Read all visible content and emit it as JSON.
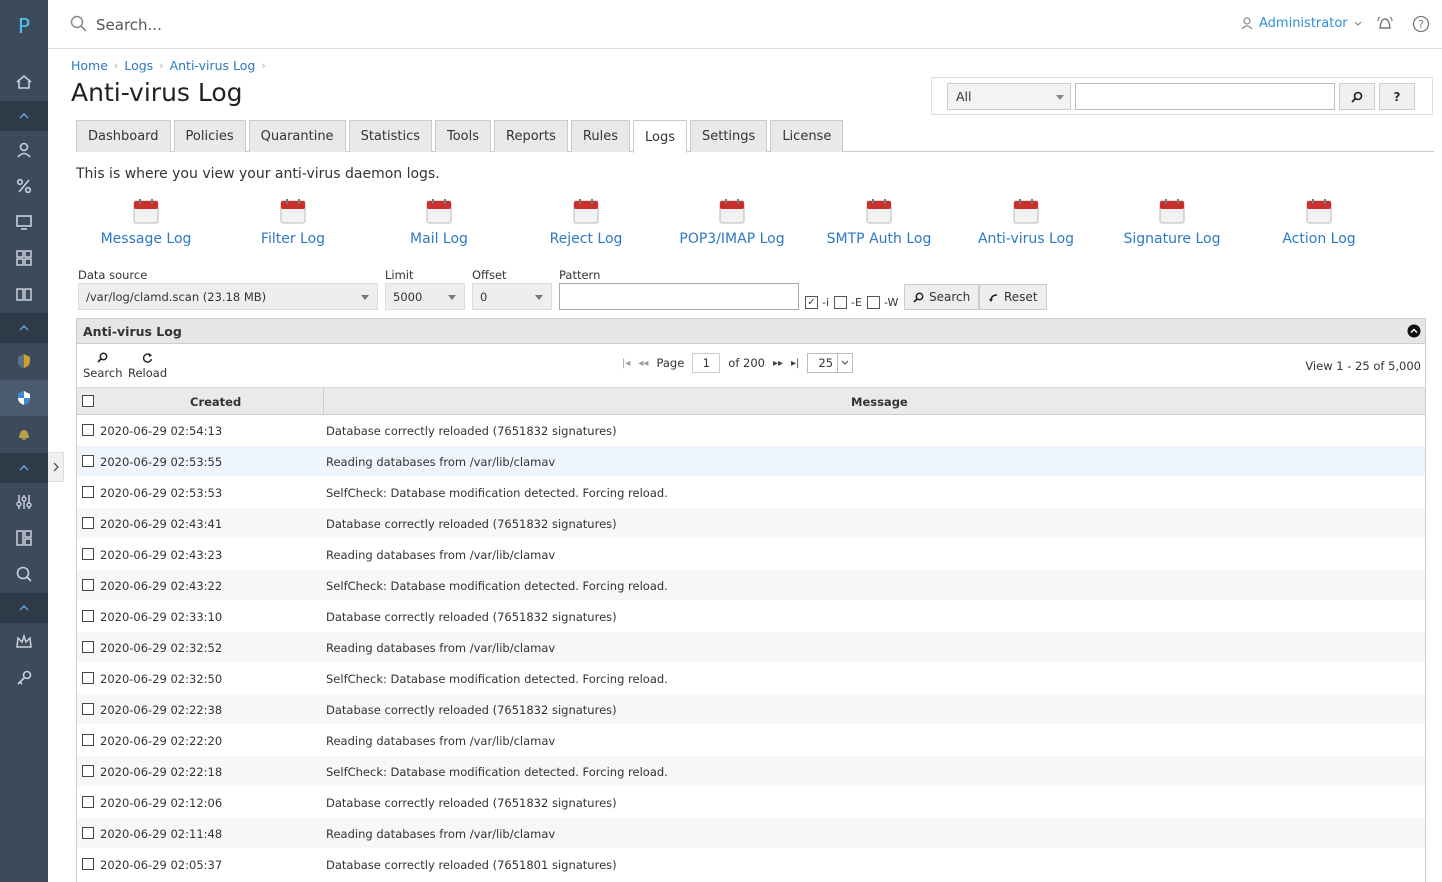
{
  "sidebar": {
    "logo": "P",
    "icons": [
      "home-icon",
      "collapse-icon",
      "user-icon",
      "percent-icon",
      "monitor-icon",
      "apps-icon",
      "book-icon",
      "collapse-icon",
      "shield-icon",
      "shield-active-icon",
      "bell-icon",
      "collapse-icon",
      "sliders-icon",
      "modules-icon",
      "search-zoom-icon",
      "collapse-icon",
      "crown-icon",
      "key-icon"
    ]
  },
  "topbar": {
    "search_placeholder": "Search...",
    "user": "Administrator"
  },
  "breadcrumb": [
    "Home",
    "Logs",
    "Anti-virus Log"
  ],
  "page_title": "Anti-virus Log",
  "right_search": {
    "scope": "All",
    "search_button": "search-icon",
    "help_button": "?"
  },
  "tabs": [
    "Dashboard",
    "Policies",
    "Quarantine",
    "Statistics",
    "Tools",
    "Reports",
    "Rules",
    "Logs",
    "Settings",
    "License"
  ],
  "active_tab": "Logs",
  "intro": "This is where you view your anti-virus daemon logs.",
  "log_links": [
    "Message Log",
    "Filter Log",
    "Mail Log",
    "Reject Log",
    "POP3/IMAP Log",
    "SMTP Auth Log",
    "Anti-virus Log",
    "Signature Log",
    "Action Log"
  ],
  "filters": {
    "data_source_label": "Data source",
    "data_source": "/var/log/clamd.scan (23.18 MB)",
    "limit_label": "Limit",
    "limit": "5000",
    "offset_label": "Offset",
    "offset": "0",
    "pattern_label": "Pattern",
    "pattern": "",
    "opt_i": "-i",
    "opt_i_checked": true,
    "opt_E": "-E",
    "opt_E_checked": false,
    "opt_W": "-W",
    "opt_W_checked": false,
    "search_btn": "Search",
    "reset_btn": "Reset"
  },
  "grid": {
    "caption": "Anti-virus Log",
    "toolbar": {
      "search": "Search",
      "reload": "Reload"
    },
    "pager": {
      "page_label": "Page",
      "page": "1",
      "of": "of 200",
      "rows": "25"
    },
    "view_info": "View 1 - 25 of 5,000",
    "columns": [
      "Created",
      "Message"
    ],
    "rows": [
      {
        "created": "2020-06-29 02:54:13",
        "message": "Database correctly reloaded (7651832 signatures)"
      },
      {
        "created": "2020-06-29 02:53:55",
        "message": "Reading databases from /var/lib/clamav"
      },
      {
        "created": "2020-06-29 02:53:53",
        "message": "SelfCheck: Database modification detected. Forcing reload."
      },
      {
        "created": "2020-06-29 02:43:41",
        "message": "Database correctly reloaded (7651832 signatures)"
      },
      {
        "created": "2020-06-29 02:43:23",
        "message": "Reading databases from /var/lib/clamav"
      },
      {
        "created": "2020-06-29 02:43:22",
        "message": "SelfCheck: Database modification detected. Forcing reload."
      },
      {
        "created": "2020-06-29 02:33:10",
        "message": "Database correctly reloaded (7651832 signatures)"
      },
      {
        "created": "2020-06-29 02:32:52",
        "message": "Reading databases from /var/lib/clamav"
      },
      {
        "created": "2020-06-29 02:32:50",
        "message": "SelfCheck: Database modification detected. Forcing reload."
      },
      {
        "created": "2020-06-29 02:22:38",
        "message": "Database correctly reloaded (7651832 signatures)"
      },
      {
        "created": "2020-06-29 02:22:20",
        "message": "Reading databases from /var/lib/clamav"
      },
      {
        "created": "2020-06-29 02:22:18",
        "message": "SelfCheck: Database modification detected. Forcing reload."
      },
      {
        "created": "2020-06-29 02:12:06",
        "message": "Database correctly reloaded (7651832 signatures)"
      },
      {
        "created": "2020-06-29 02:11:48",
        "message": "Reading databases from /var/lib/clamav"
      },
      {
        "created": "2020-06-29 02:05:37",
        "message": "Database correctly reloaded (7651801 signatures)"
      }
    ]
  },
  "colors": {
    "sidebar": "#3d4a5c",
    "link": "#2f78c4",
    "accent": "#2f8fd8"
  }
}
